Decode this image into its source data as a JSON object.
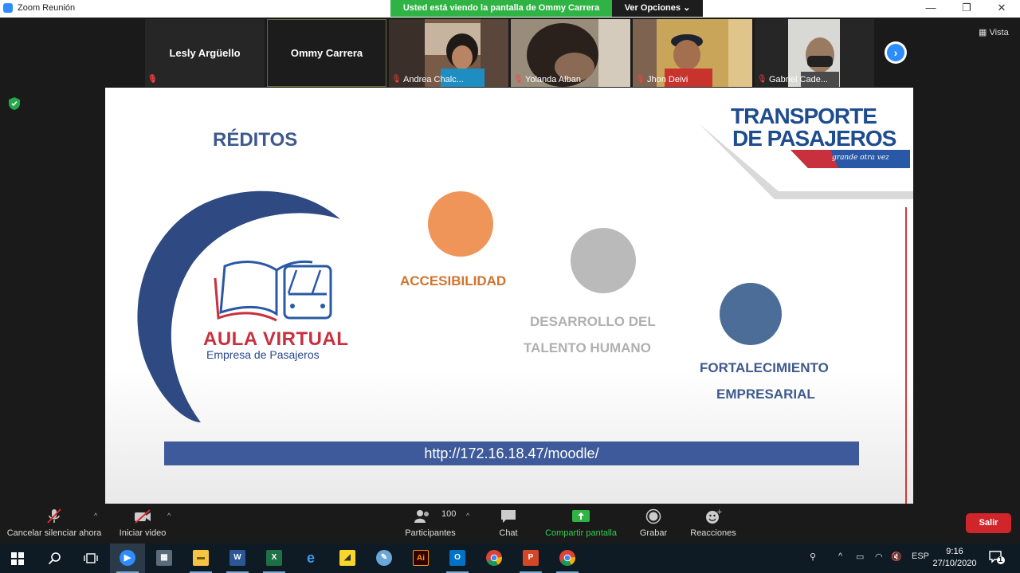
{
  "window": {
    "title": "Zoom Reunión",
    "minimize": "—",
    "restore": "❐",
    "close": "✕"
  },
  "share_banner": "Usted está viendo la pantalla de Ommy Carrera",
  "view_options": "Ver Opciones ⌄",
  "gallery": {
    "participants": [
      {
        "name": "Lesly Argüello",
        "video": false,
        "muted": true
      },
      {
        "name": "Ommy Carrera",
        "video": false,
        "muted": false,
        "active": true
      },
      {
        "name": "Andrea Chalc...",
        "video": true,
        "muted": true
      },
      {
        "name": "Yolanda Alban",
        "video": true,
        "muted": true
      },
      {
        "name": "Jhon Deivi",
        "video": true,
        "muted": true
      },
      {
        "name": "Gabriel Cade...",
        "video": true,
        "muted": true
      }
    ],
    "view_label": "Vista"
  },
  "slide": {
    "heading": "RÉDITOS",
    "brand_line1": "TRANSPORTE",
    "brand_line2": "DE PASAJEROS",
    "brand_tagline": "grande otra vez",
    "logo_title": "AULA VIRTUAL",
    "logo_subtitle": "Empresa de Pasajeros",
    "item1": "ACCESIBILIDAD",
    "item2_line1": "DESARROLLO DEL",
    "item2_line2": "TALENTO HUMANO",
    "item3_line1": "FORTALECIMIENTO",
    "item3_line2": "EMPRESARIAL",
    "url": "http://172.16.18.47/moodle/",
    "colors": {
      "orange": "#f0955a",
      "gray": "#bababb",
      "blue": "#4b6d97",
      "navy": "#3e5a8c"
    }
  },
  "controls": {
    "unmute": "Cancelar silenciar ahora",
    "start_video": "Iniciar video",
    "participants": "Participantes",
    "participants_count": "100",
    "chat": "Chat",
    "share_screen": "Compartir pantalla",
    "record": "Grabar",
    "reactions": "Reacciones",
    "leave": "Salir"
  },
  "taskbar": {
    "apps": [
      "windows-start",
      "search",
      "task-view",
      "zoom",
      "calculator",
      "file-explorer",
      "word",
      "excel",
      "edge",
      "sticky-notes",
      "paint",
      "illustrator",
      "outlook",
      "chrome",
      "powerpoint",
      "chrome"
    ],
    "language": "ESP",
    "time": "9:16",
    "date": "27/10/2020",
    "notifications": "1"
  }
}
